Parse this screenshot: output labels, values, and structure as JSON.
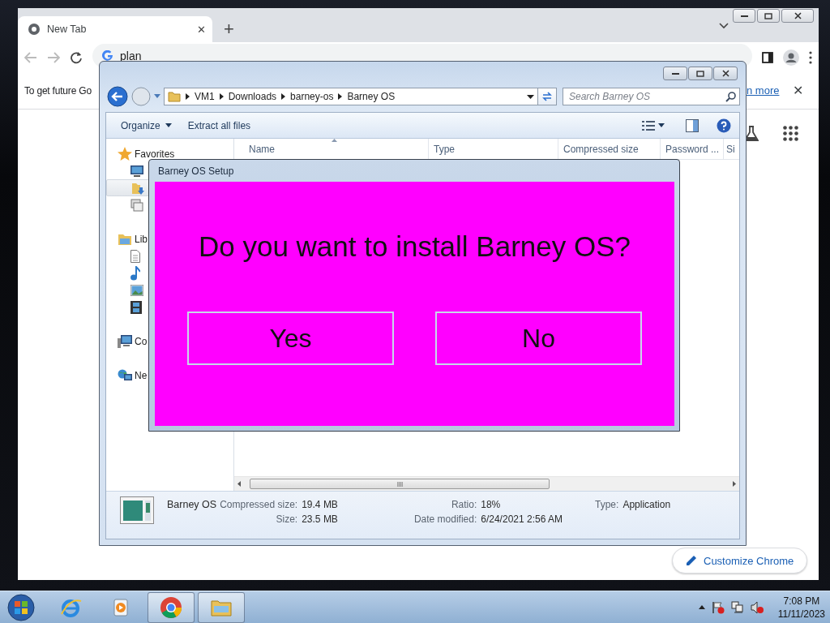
{
  "chrome": {
    "tab": {
      "title": "New Tab",
      "close": "✕",
      "selected": true
    },
    "new_tab": "+",
    "address": "plan",
    "info_bar": {
      "text": "To get future Go",
      "link": "n more",
      "close": "✕"
    },
    "customize": "Customize Chrome"
  },
  "explorer": {
    "breadcrumb": [
      "VM1",
      "Downloads",
      "barney-os",
      "Barney OS"
    ],
    "search": {
      "placeholder": "Search Barney OS"
    },
    "toolbar": [
      {
        "label": "Organize",
        "menu": true
      },
      {
        "label": "Extract all files",
        "menu": false
      }
    ],
    "sidebar": [
      {
        "label": "Favorites",
        "kind": "star",
        "children": [
          {
            "kind": "desktop",
            "selected": false
          },
          {
            "kind": "downloads",
            "selected": true
          },
          {
            "kind": "recent",
            "selected": false
          }
        ]
      },
      {
        "label": "Lib",
        "kind": "library",
        "children": [
          {
            "kind": "document",
            "selected": false
          },
          {
            "kind": "music",
            "selected": false
          },
          {
            "kind": "picture",
            "selected": false
          },
          {
            "kind": "video",
            "selected": false
          }
        ]
      },
      {
        "label": "Co",
        "kind": "computer"
      },
      {
        "label": "Ne",
        "kind": "network"
      }
    ],
    "columns": [
      {
        "label": "Name",
        "sorted": true
      },
      {
        "label": "Type",
        "sorted": false
      },
      {
        "label": "Compressed size",
        "sorted": false
      },
      {
        "label": "Password ...",
        "sorted": false
      },
      {
        "label": "Si",
        "sorted": false
      }
    ],
    "details": {
      "name": "Barney OS",
      "columns": [
        [
          {
            "label": "Compressed size:",
            "value": "19.4 MB"
          },
          {
            "label": "Size:",
            "value": "23.5 MB"
          }
        ],
        [
          {
            "label": "Ratio:",
            "value": "18%"
          },
          {
            "label": "Date modified:",
            "value": "6/24/2021 2:56 AM"
          }
        ],
        [
          {
            "label": "Type:",
            "value": "Application"
          }
        ]
      ]
    }
  },
  "dialog": {
    "title": "Barney OS Setup",
    "question": "Do you want to install Barney OS?",
    "buttons": [
      "Yes",
      "No"
    ]
  },
  "taskbar": {
    "apps": [
      {
        "kind": "ie",
        "active": false
      },
      {
        "kind": "media",
        "active": false
      },
      {
        "kind": "chrome",
        "active": true
      },
      {
        "kind": "folder",
        "active": true
      }
    ],
    "time": "7:08 PM",
    "date": "11/11/2023"
  }
}
